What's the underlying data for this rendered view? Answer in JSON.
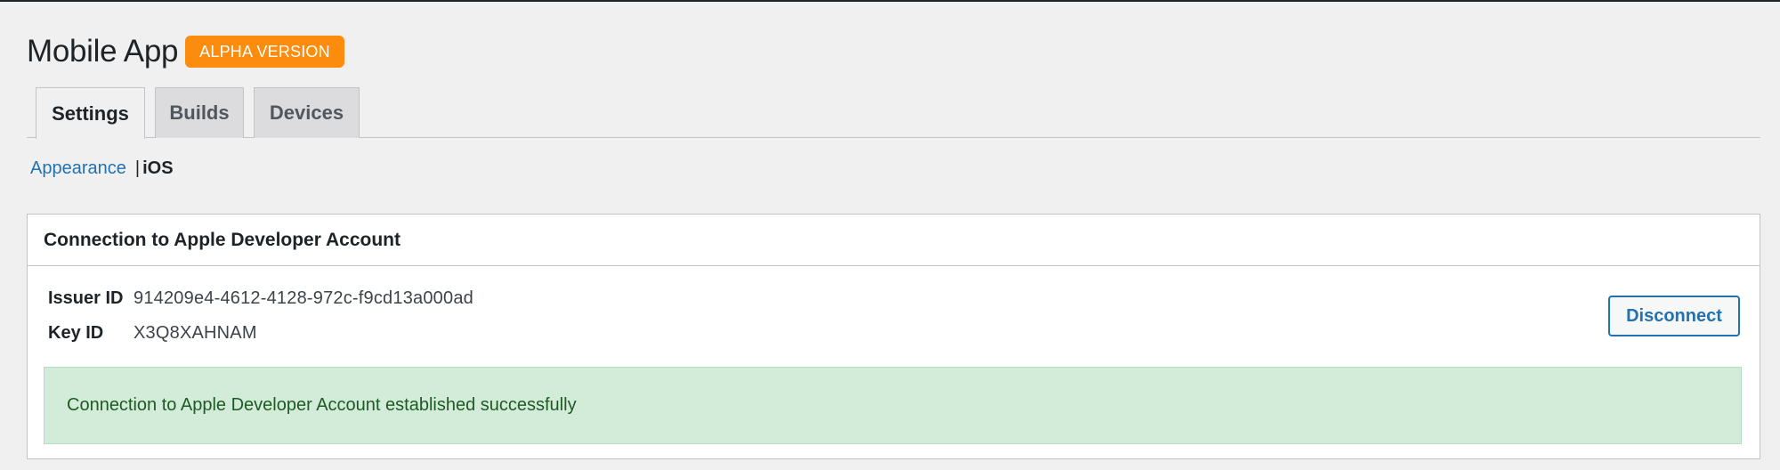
{
  "header": {
    "title": "Mobile App",
    "badge": "ALPHA VERSION"
  },
  "tabs": [
    {
      "label": "Settings",
      "active": true
    },
    {
      "label": "Builds",
      "active": false
    },
    {
      "label": "Devices",
      "active": false
    }
  ],
  "subnav": {
    "link_label": "Appearance",
    "separator": "|",
    "current_label": "iOS"
  },
  "panel": {
    "title": "Connection to Apple Developer Account",
    "issuer_label": "Issuer ID",
    "issuer_value": "914209e4-4612-4128-972c-f9cd13a000ad",
    "key_label": "Key ID",
    "key_value": "X3Q8XAHNAM",
    "disconnect_label": "Disconnect",
    "notice": "Connection to Apple Developer Account established successfully"
  },
  "colors": {
    "accent": "#2271b1",
    "badge": "#fb8c0d",
    "success_bg": "#d3ecda",
    "success_text": "#1e5a23"
  }
}
